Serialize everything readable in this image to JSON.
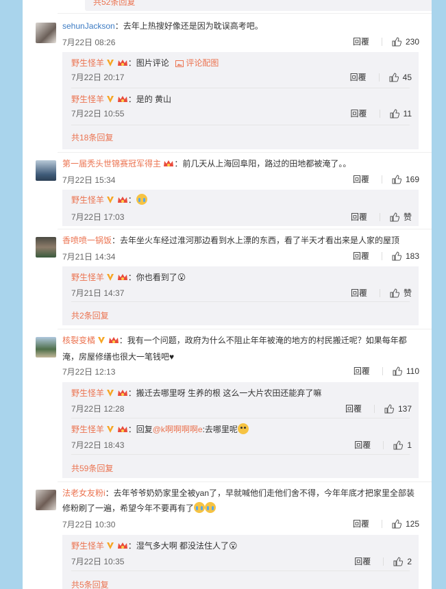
{
  "top_more": "共52条回复",
  "icons": [
    "like-icon",
    "verified-v-icon",
    "vip-crown-icon",
    "image-comment-icon"
  ],
  "colors": {
    "accent": "#eb7350",
    "page_bg": "#a9d4ec",
    "sub_bg": "#f2f2f5"
  },
  "reply_label": "回覆",
  "comments": [
    {
      "user": "sehunJackson",
      "text": "：去年上热搜好像还是因为耽误高考吧。",
      "time": "7月22日 08:26",
      "likes": "230",
      "replies": [
        {
          "user": "野生怪羊",
          "text": "：图片评论",
          "link": "评论配图",
          "time": "7月22日 20:17",
          "likes": "45"
        },
        {
          "user": "野生怪羊",
          "text": "：是的 黄山",
          "time": "7月22日 10:55",
          "likes": "11"
        }
      ],
      "more": "共18条回复"
    },
    {
      "user": "第一届秃头世锦赛冠军得主",
      "text": "：前几天从上海回阜阳，路过的田地都被淹了。。",
      "time": "7月22日 15:34",
      "likes": "169",
      "replies": [
        {
          "user": "野生怪羊",
          "text": "：",
          "time": "7月22日 17:03",
          "likes": "赞"
        }
      ]
    },
    {
      "user": "香喷喷一锅饭",
      "text": "：去年坐火车经过淮河那边看到水上漂的东西，看了半天才看出来是人家的屋顶",
      "time": "7月21日 14:34",
      "likes": "183",
      "replies": [
        {
          "user": "野生怪羊",
          "text": "：你也看到了😮",
          "time": "7月21日 14:37",
          "likes": "赞"
        }
      ],
      "more": "共2条回复"
    },
    {
      "user": "核裂变橘",
      "text_line1": "：我有一个问题，政府为什么不阻止年年被淹的地方的村民搬迁呢？如果每年都",
      "text_line2": "淹，房屋修缮也很大一笔钱吧",
      "time": "7月22日 12:13",
      "likes": "110",
      "replies": [
        {
          "user": "野生怪羊",
          "text": "：搬迁去哪里呀 生养的根 这么一大片农田还能弃了嘛",
          "time": "7月22日 12:28",
          "likes": "137"
        },
        {
          "user": "野生怪羊",
          "text_pre": "：回复",
          "mention": "@k啊啊啊啊e",
          "text_post": ":去哪里呢",
          "time": "7月22日 18:43",
          "likes": "1"
        }
      ],
      "more": "共59条回复"
    },
    {
      "user": "法老女友粉i",
      "text_line1": "：去年爷爷奶奶家里全被yan了，早就喊他们走他们舍不得，今年年底才把家里全部装",
      "text_line2": "修粉刷了一遍，希望今年不要再有了",
      "time": "7月22日 10:30",
      "likes": "125",
      "replies": [
        {
          "user": "野生怪羊",
          "text": "：湿气多大啊 都没法住人了😮",
          "time": "7月22日 10:35",
          "likes": "2"
        }
      ],
      "more": "共5条回复"
    }
  ]
}
